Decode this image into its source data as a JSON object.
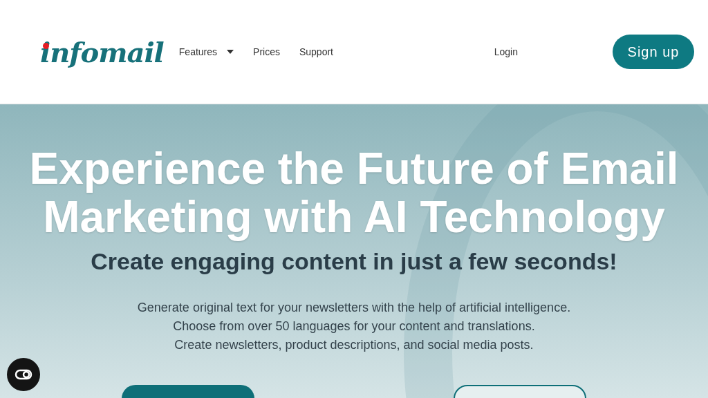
{
  "header": {
    "logo": "infomail",
    "nav": [
      {
        "label": "Features",
        "has_menu": true
      },
      {
        "label": "Prices",
        "has_menu": false
      },
      {
        "label": "Support",
        "has_menu": false
      }
    ],
    "login": "Login",
    "signup": "Sign up"
  },
  "hero": {
    "title_lines": [
      "Experience the Future of Email",
      "Marketing with AI Technology"
    ],
    "subtitle": "Create engaging content in just a few seconds!",
    "lines": [
      "Generate original text for your newsletters with the help of artificial intelligence.",
      "Choose from over 50 languages for your content and translations.",
      "Create newsletters, product descriptions, and social media posts."
    ],
    "buttons": [
      {
        "kind": "filled"
      },
      {
        "kind": "outline"
      }
    ]
  }
}
